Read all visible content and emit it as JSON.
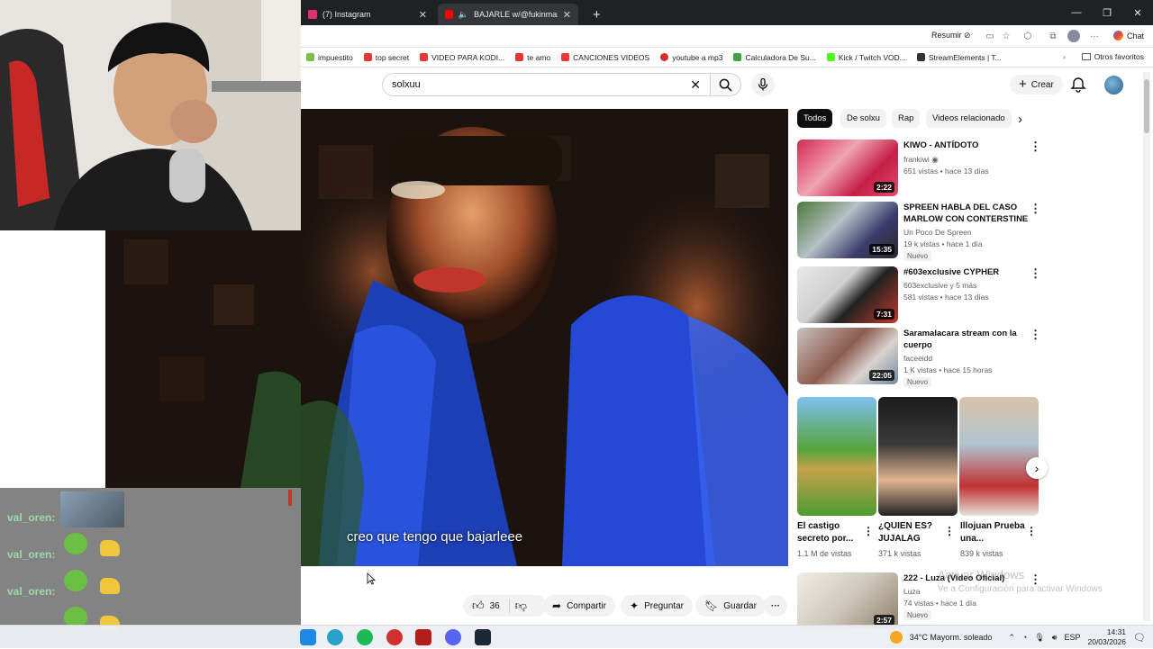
{
  "browser": {
    "tabs": [
      {
        "label": "(7) Instagram",
        "active": false
      },
      {
        "label": "BAJARLE w/@fukinmari - You",
        "active": true
      }
    ],
    "new_tab": "+",
    "resumir_label": "Resumir",
    "chat_label": "Chat",
    "bookmarks": [
      "impuestito",
      "top secret",
      "VIDEO PARA KODI...",
      "te amo",
      "CANCIONES VIDEOS",
      "youtube a mp3",
      "Calculadora De Su...",
      "Kick / Twitch VOD...",
      "StreamElements | T..."
    ],
    "other_bookmarks": "Otros favoritos"
  },
  "youtube": {
    "search_value": "solxuu",
    "create_label": "Crear",
    "subtitle": "creo que tengo que bajarleee",
    "actions": {
      "likes": "36",
      "share": "Compartir",
      "ask": "Preguntar",
      "save": "Guardar"
    },
    "chips": [
      "Todos",
      "De solxu",
      "Rap",
      "Videos relacionado"
    ],
    "recommendations": [
      {
        "title": "KIWO - ANTÍDOTO",
        "channel": "frankiwi",
        "meta": "651 vistas • hace 13 días",
        "duration": "2:22",
        "badge": ""
      },
      {
        "title": "SPREEN HABLA DEL CASO MARLOW CON CONTERSTINE ...",
        "channel": "Un Poco De Spreen",
        "meta": "19 k vistas • hace 1 día",
        "duration": "15:35",
        "badge": "Nuevo"
      },
      {
        "title": "#603exclusive CYPHER",
        "channel": "603exclusive y 5 más",
        "meta": "581 vistas • hace 13 días",
        "duration": "7:31",
        "badge": ""
      },
      {
        "title": "Saramalacara stream con la cuerpo",
        "channel": "faceeidd",
        "meta": "1 K vistas • hace 15 horas",
        "duration": "22:05",
        "badge": "Nuevo"
      }
    ],
    "shorts": [
      {
        "title": "El castigo secreto por...",
        "views": "1.1 M de vistas"
      },
      {
        "title": "¿QUIEN ES? JUJALAG",
        "views": "371 k vistas"
      },
      {
        "title": "Illojuan Prueba una...",
        "views": "839 k vistas"
      }
    ],
    "last_rec": {
      "title": "222 - Luza (Video Oficial)",
      "channel": "Luza",
      "meta": "74 vistas • hace 1 día",
      "duration": "2:57",
      "badge": "Nuevo"
    }
  },
  "overlay": {
    "chat_user": "val_oren:",
    "activation": [
      "Activar Windows",
      "Ve a Configuración para activar Windows"
    ]
  },
  "taskbar": {
    "weather": "34°C  Mayorm. soleado",
    "lang": "ESP",
    "time": "14:31",
    "date": "20/03/2026"
  }
}
